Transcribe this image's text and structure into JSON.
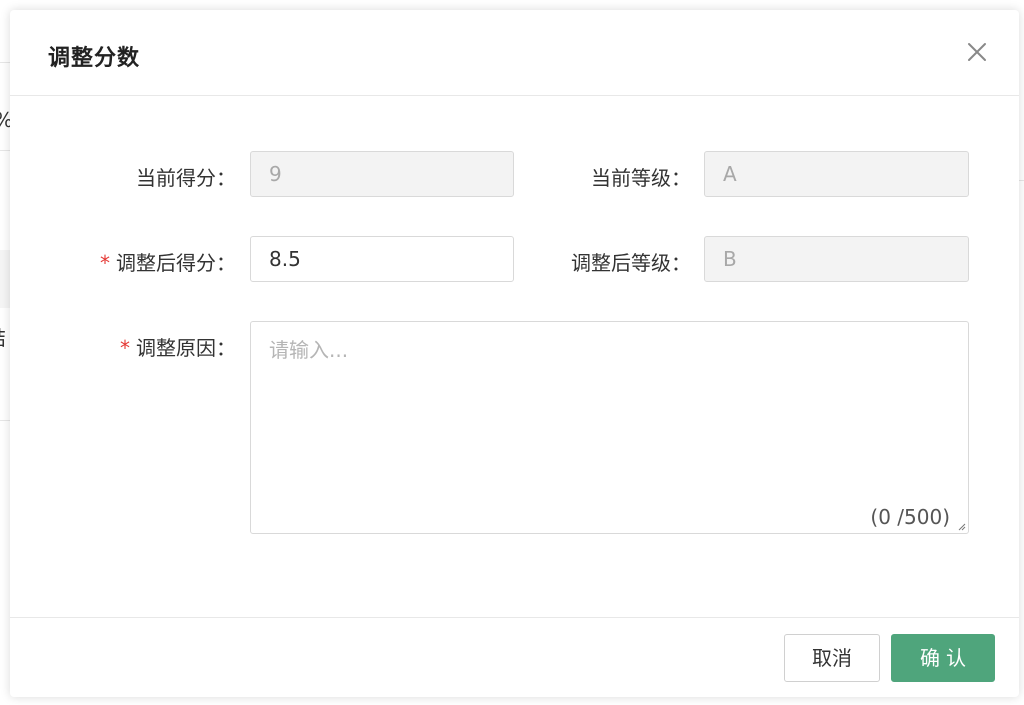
{
  "background": {
    "fragment_1": "%",
    "fragment_2": "结"
  },
  "dialog": {
    "title": "调整分数",
    "close_icon": "close-icon",
    "fields": {
      "current_score": {
        "label": "当前得分：",
        "value": "9"
      },
      "current_grade": {
        "label": "当前等级：",
        "value": "A"
      },
      "adjusted_score": {
        "label": "调整后得分：",
        "value": "8.5",
        "required_mark": "*"
      },
      "adjusted_grade": {
        "label": "调整后等级：",
        "value": "B"
      },
      "reason": {
        "label": "调整原因：",
        "required_mark": "*",
        "placeholder": "请输入...",
        "value": "",
        "char_count": "(0 /500)"
      }
    },
    "footer": {
      "cancel_label": "取消",
      "confirm_label": "确认"
    }
  },
  "colors": {
    "primary": "#4fa57c",
    "required": "#e53935",
    "disabled_bg": "#f3f3f3"
  }
}
